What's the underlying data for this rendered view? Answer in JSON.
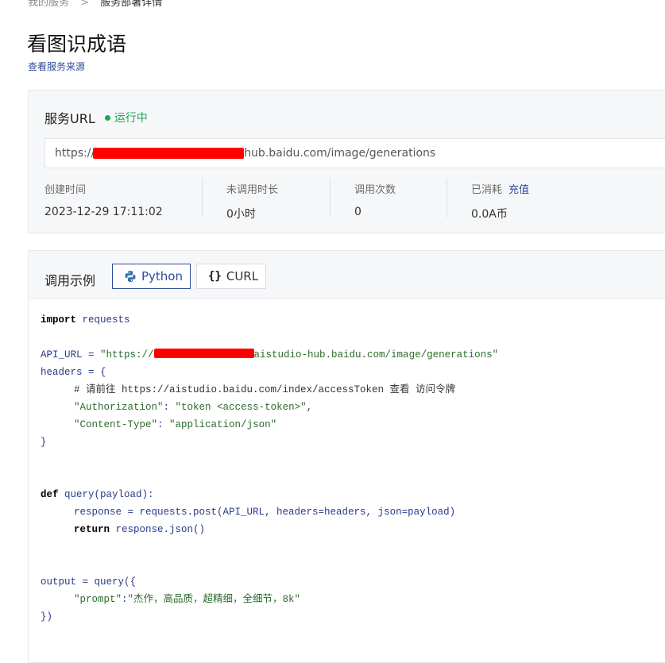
{
  "breadcrumb": {
    "parent": "我的服务",
    "separator": ">",
    "current": "服务部署详情"
  },
  "page": {
    "title": "看图识成语",
    "source_link": "查看服务来源"
  },
  "service": {
    "url_label": "服务URL",
    "status": "运行中",
    "url_prefix": "https://",
    "url_suffix": "hub.baidu.com/image/generations",
    "stats": [
      {
        "key": "创建时间",
        "value": "2023-12-29 17:11:02"
      },
      {
        "key": "未调用时长",
        "value": "0小时"
      },
      {
        "key": "调用次数",
        "value": "0"
      },
      {
        "key": "已消耗",
        "value": "0.0A币",
        "action": "充值"
      }
    ]
  },
  "example": {
    "label": "调用示例",
    "tabs": [
      {
        "label": "Python",
        "icon": "python-icon",
        "active": true
      },
      {
        "label": "CURL",
        "icon": "braces-icon",
        "active": false
      }
    ],
    "code": {
      "l1_kw": "import",
      "l1_rest": " requests",
      "l3_a": "API_URL = ",
      "l3_str_a": "\"https://",
      "l3_str_b": "aistudio-hub.baidu.com/image/generations\"",
      "l4": "headers = {",
      "l5": "# 请前往 https://aistudio.baidu.com/index/accessToken 查看 访问令牌",
      "l6_key": "\"Authorization\"",
      "l6_colon": ": ",
      "l6_val": "\"token <access-token>\"",
      "l6_end": ",",
      "l7_key": "\"Content-Type\"",
      "l7_colon": ": ",
      "l7_val": "\"application/json\"",
      "l8": "}",
      "l11_kw": "def",
      "l11_rest": " query(payload):",
      "l12": "response = requests.post(API_URL, headers=headers, json=payload)",
      "l13_kw": "return",
      "l13_rest": " response.json()",
      "l16": "output = query({",
      "l17_key": "\"prompt\"",
      "l17_colon": ":",
      "l17_val": "\"杰作，高品质，超精细，全细节，8k\"",
      "l18": "})"
    }
  },
  "colors": {
    "accent": "#2e4a9b",
    "running": "#1aa850",
    "redaction": "#ff0000"
  }
}
